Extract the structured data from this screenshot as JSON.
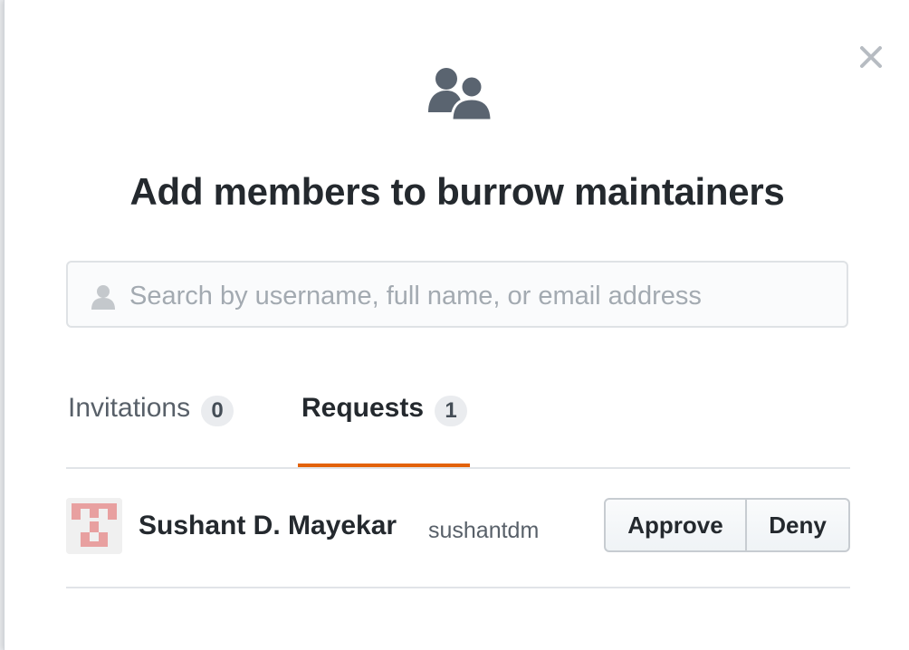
{
  "dialog": {
    "icons": {
      "close": "close-icon",
      "team": "people-icon",
      "search": "person-icon"
    },
    "title_prefix": "Add members to",
    "team_name": "burrow maintainers",
    "search": {
      "placeholder": "Search by username, full name, or email address",
      "value": ""
    },
    "tabs": [
      {
        "label": "Invitations",
        "count": "0",
        "selected": false
      },
      {
        "label": "Requests",
        "count": "1",
        "selected": true
      }
    ],
    "requests": [
      {
        "full_name": "Sushant D. Mayekar",
        "login": "sushantdm",
        "approve_label": "Approve",
        "deny_label": "Deny"
      }
    ]
  },
  "colors": {
    "selected_tab_underline": "#e36209",
    "text_primary": "#24292e",
    "text_muted": "#586069",
    "avatar_identicon": "#e8a0a0"
  }
}
